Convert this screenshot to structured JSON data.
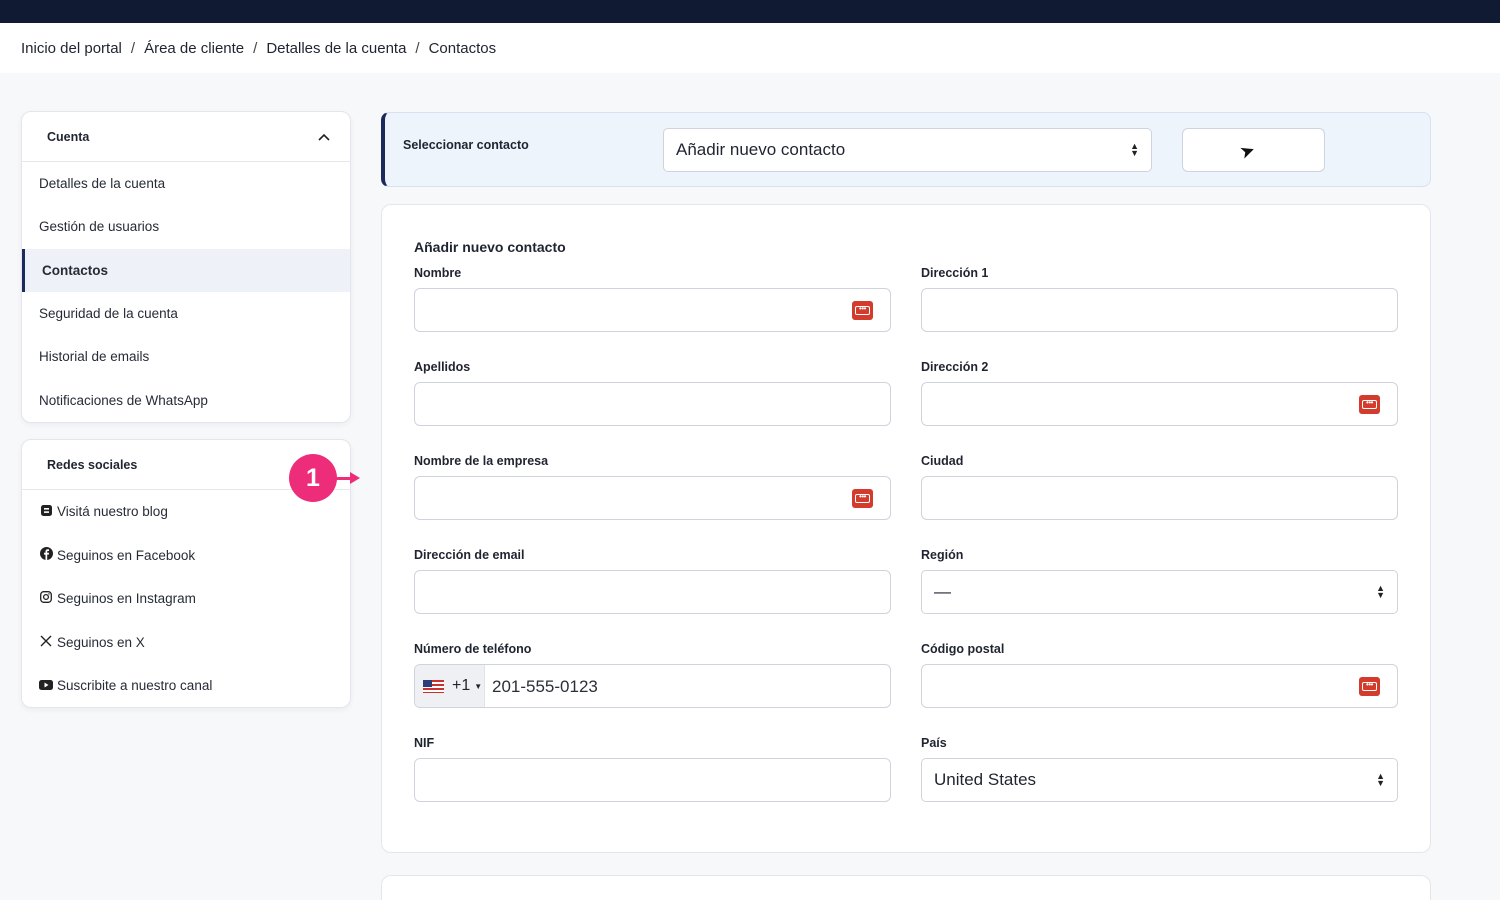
{
  "breadcrumb": [
    "Inicio del portal",
    "Área de cliente",
    "Detalles de la cuenta",
    "Contactos"
  ],
  "breadcrumb_separator": "/",
  "sidebar": {
    "title": "Cuenta",
    "items": [
      {
        "label": "Detalles de la cuenta",
        "active": false
      },
      {
        "label": "Gestión de usuarios",
        "active": false
      },
      {
        "label": "Contactos",
        "active": true
      },
      {
        "label": "Seguridad de la cuenta",
        "active": false
      },
      {
        "label": "Historial de emails",
        "active": false
      },
      {
        "label": "Notificaciones de WhatsApp",
        "active": false
      }
    ]
  },
  "social": {
    "title": "Redes sociales",
    "items": [
      {
        "label": "Visitá nuestro blog",
        "icon": "blog-icon"
      },
      {
        "label": "Seguinos en Facebook",
        "icon": "facebook-icon"
      },
      {
        "label": "Seguinos en Instagram",
        "icon": "instagram-icon"
      },
      {
        "label": "Seguinos en X",
        "icon": "x-icon"
      },
      {
        "label": "Suscribite a nuestro canal",
        "icon": "youtube-icon"
      }
    ]
  },
  "contact_selector": {
    "label": "Seleccionar contacto",
    "selected": "Añadir nuevo contacto"
  },
  "form": {
    "title": "Añadir nuevo contacto",
    "nombre": "Nombre",
    "apellidos": "Apellidos",
    "empresa": "Nombre de la empresa",
    "email": "Dirección de email",
    "telefono": "Número de teléfono",
    "nif": "NIF",
    "direccion1": "Dirección 1",
    "direccion2": "Dirección 2",
    "ciudad": "Ciudad",
    "region": "Región",
    "region_value": "—",
    "codigo_postal": "Código postal",
    "pais": "País",
    "pais_value": "United States",
    "phone_code": "+1",
    "phone_value": "201-555-0123"
  },
  "annotation": {
    "step": "1"
  },
  "colors": {
    "topbar": "#101a33",
    "accent": "#1b2a5a",
    "badge": "#ee2d7a",
    "password_icon": "#d33b2d"
  }
}
